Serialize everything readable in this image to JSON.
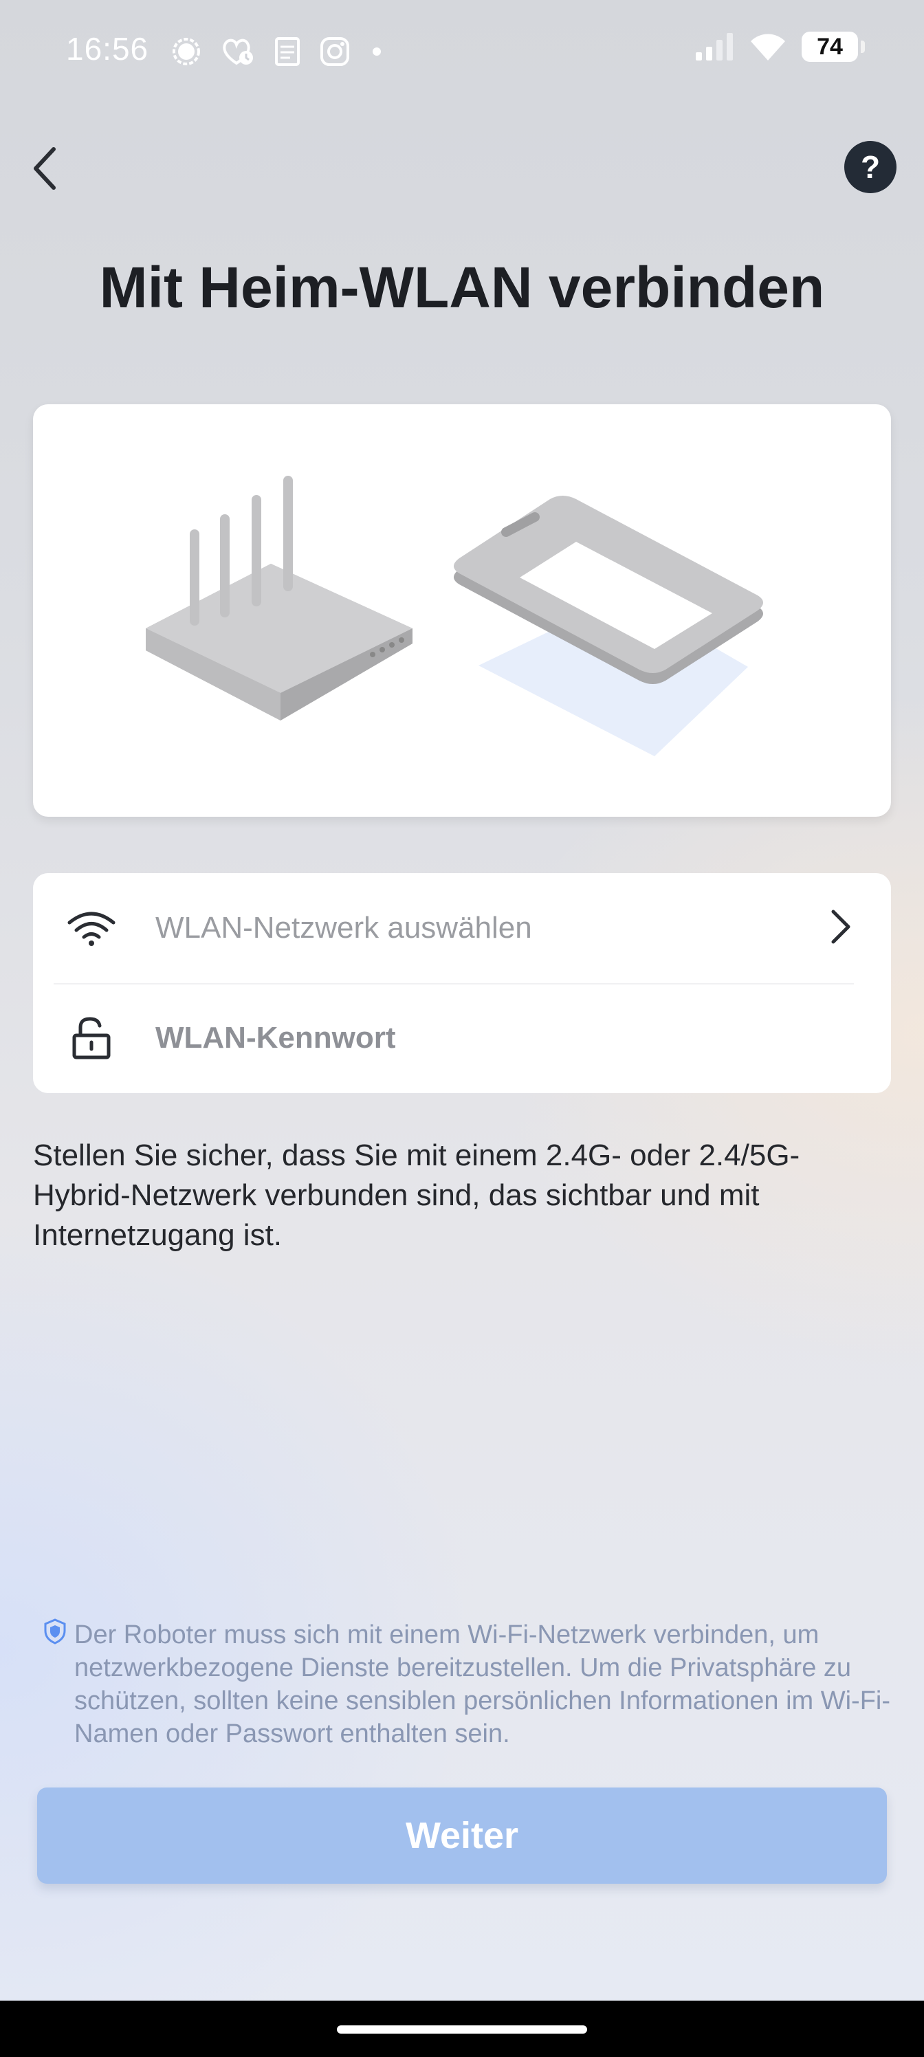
{
  "status_bar": {
    "time": "16:56",
    "battery": "74",
    "notification_icons": [
      "signal-app-icon",
      "health-app-icon",
      "notes-app-icon",
      "instagram-icon",
      "dot-icon"
    ],
    "right_icons": [
      "cellular-signal-icon",
      "wifi-icon",
      "battery-icon"
    ]
  },
  "header": {
    "title": "Mit Heim-WLAN verbinden",
    "back_icon": "chevron-left-icon",
    "help_label": "?"
  },
  "illustration": {
    "description_icons": [
      "router-icon",
      "phone-icon"
    ]
  },
  "form": {
    "network_placeholder": "WLAN-Netzwerk auswählen",
    "password_label": "WLAN-Kennwort",
    "network_icon": "wifi-icon",
    "password_icon": "unlock-icon",
    "chevron_icon": "chevron-right-icon"
  },
  "info_text": "Stellen Sie sicher, dass Sie mit einem 2.4G- oder 2.4/5G-Hybrid-Netzwerk verbunden sind, das sichtbar und mit Internetzugang ist.",
  "privacy_text": "Der Roboter muss sich mit einem Wi-Fi-Netzwerk verbinden, um netzwerkbezogene Dienste bereitzustellen. Um die Privatsphäre zu schützen, sollten keine sensiblen persönlichen Informationen im Wi-Fi-Namen oder Passwort enthalten sein.",
  "continue_button": "Weiter",
  "colors": {
    "primary_disabled": "#a2c0ee",
    "help_bg": "#232b36",
    "title": "#1d1f24",
    "privacy_text": "#8a97b3"
  }
}
